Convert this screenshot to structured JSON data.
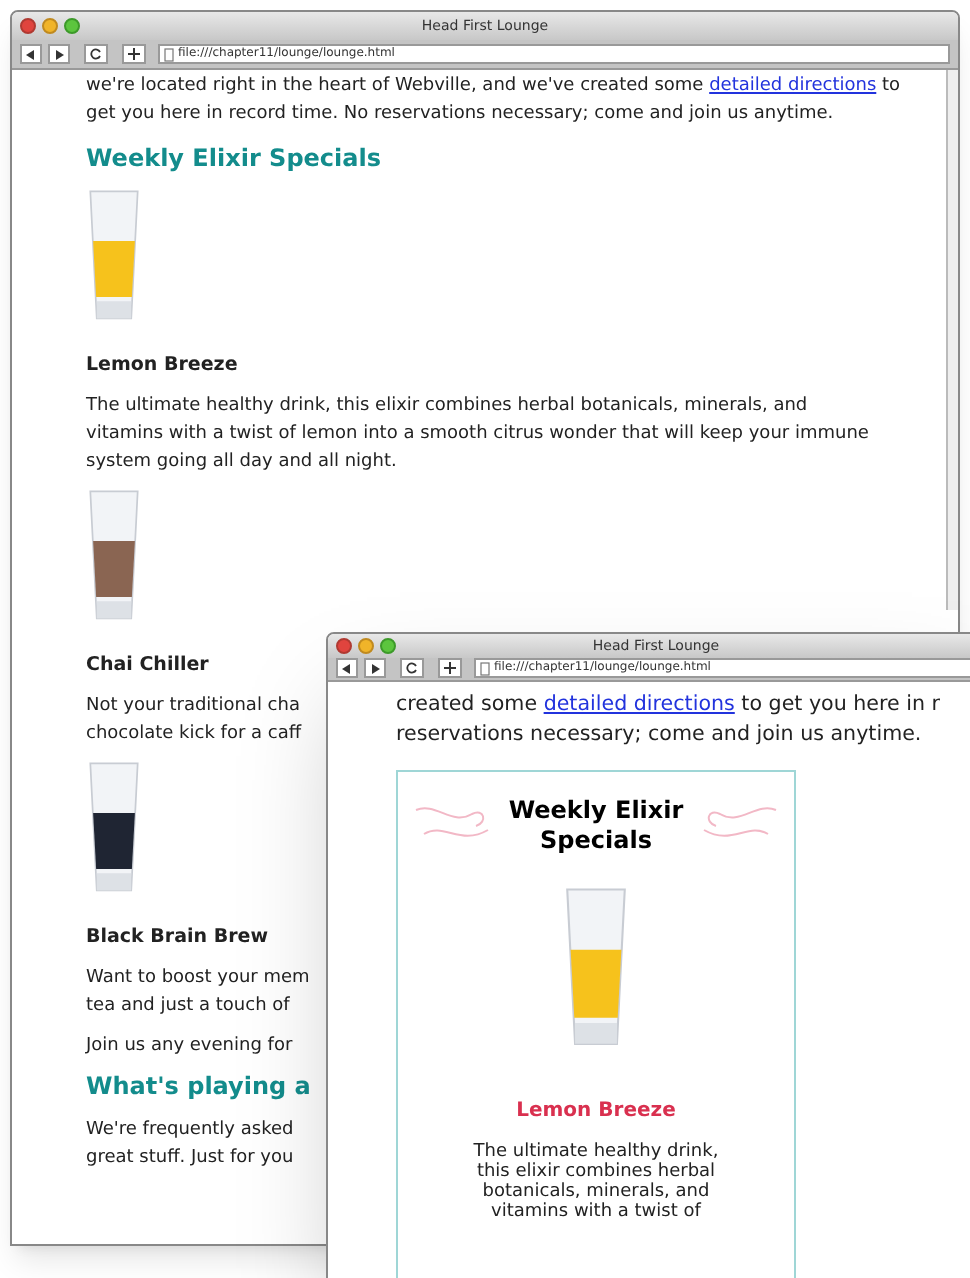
{
  "back_window": {
    "title": "Head First Lounge",
    "address": "file:///chapter11/lounge/lounge.html",
    "content": [
      {
        "kind": "paragraph",
        "text_before": "we're located right in the heart of Webville, and we've created some",
        "link": "detailed directions",
        "text_after": "to get you here in record time. No reservations necessary; come and join us anytime."
      },
      {
        "kind": "heading",
        "text": "Weekly Elixir Specials"
      },
      {
        "kind": "drink",
        "name": "Lemon Breeze",
        "color": "#f6c21c",
        "lines": [
          "The ultimate healthy drink, this elixir combines herbal botanicals, minerals, and",
          "vitamins with a twist of lemon into a smooth citrus wonder that will keep your immune",
          "system going all day and all night."
        ]
      },
      {
        "kind": "drink",
        "name": "Chai Chiller",
        "color": "#8a6552",
        "lines": [
          "Not your traditional cha",
          "chocolate kick for a caff"
        ]
      },
      {
        "kind": "drink",
        "name": "Black Brain Brew",
        "color": "#1f2533",
        "lines": [
          "Want to boost your mem",
          "tea and just a touch of"
        ]
      },
      {
        "kind": "lines",
        "lines": [
          "Join us any evening for"
        ]
      },
      {
        "kind": "heading",
        "text": "What's playing a"
      },
      {
        "kind": "lines",
        "lines": [
          "We're frequently asked",
          "great stuff. Just for you"
        ]
      }
    ]
  },
  "front_window": {
    "title": "Head First Lounge",
    "address": "file:///chapter11/lounge/lounge.html",
    "intro_lines": [
      {
        "text_before": "created some",
        "link": "detailed directions",
        "text_after": "to get you here in r"
      },
      {
        "text_before": "reservations necessary; come and join us anytime."
      }
    ],
    "box": {
      "heading": "Weekly Elixir Specials",
      "drink": {
        "name": "Lemon Breeze",
        "color": "#f6c21c"
      },
      "lines": [
        "The ultimate healthy drink,",
        "this elixir combines herbal",
        "botanicals, minerals, and",
        "vitamins with a twist of"
      ]
    }
  }
}
